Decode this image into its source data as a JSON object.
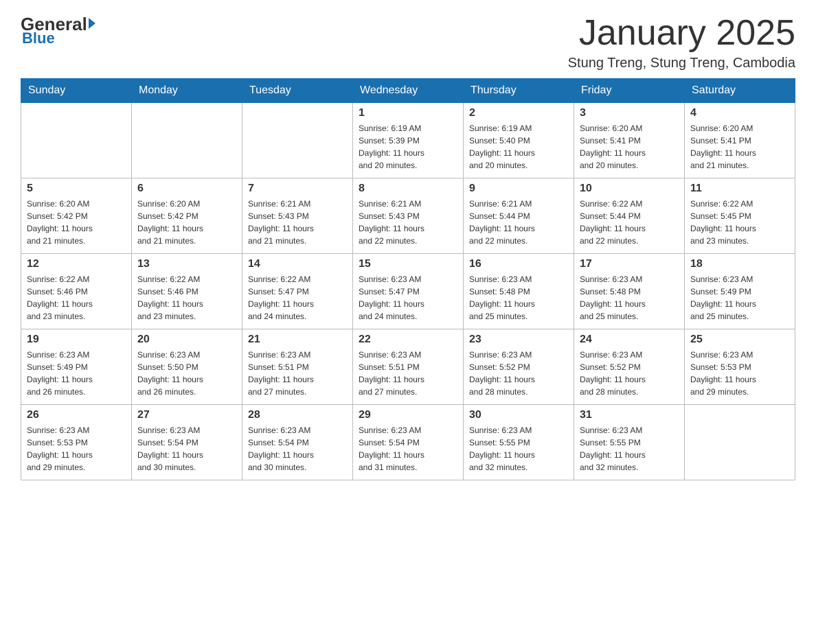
{
  "logo": {
    "general": "General",
    "blue": "Blue"
  },
  "title": "January 2025",
  "location": "Stung Treng, Stung Treng, Cambodia",
  "weekdays": [
    "Sunday",
    "Monday",
    "Tuesday",
    "Wednesday",
    "Thursday",
    "Friday",
    "Saturday"
  ],
  "weeks": [
    [
      {
        "day": "",
        "info": ""
      },
      {
        "day": "",
        "info": ""
      },
      {
        "day": "",
        "info": ""
      },
      {
        "day": "1",
        "info": "Sunrise: 6:19 AM\nSunset: 5:39 PM\nDaylight: 11 hours\nand 20 minutes."
      },
      {
        "day": "2",
        "info": "Sunrise: 6:19 AM\nSunset: 5:40 PM\nDaylight: 11 hours\nand 20 minutes."
      },
      {
        "day": "3",
        "info": "Sunrise: 6:20 AM\nSunset: 5:41 PM\nDaylight: 11 hours\nand 20 minutes."
      },
      {
        "day": "4",
        "info": "Sunrise: 6:20 AM\nSunset: 5:41 PM\nDaylight: 11 hours\nand 21 minutes."
      }
    ],
    [
      {
        "day": "5",
        "info": "Sunrise: 6:20 AM\nSunset: 5:42 PM\nDaylight: 11 hours\nand 21 minutes."
      },
      {
        "day": "6",
        "info": "Sunrise: 6:20 AM\nSunset: 5:42 PM\nDaylight: 11 hours\nand 21 minutes."
      },
      {
        "day": "7",
        "info": "Sunrise: 6:21 AM\nSunset: 5:43 PM\nDaylight: 11 hours\nand 21 minutes."
      },
      {
        "day": "8",
        "info": "Sunrise: 6:21 AM\nSunset: 5:43 PM\nDaylight: 11 hours\nand 22 minutes."
      },
      {
        "day": "9",
        "info": "Sunrise: 6:21 AM\nSunset: 5:44 PM\nDaylight: 11 hours\nand 22 minutes."
      },
      {
        "day": "10",
        "info": "Sunrise: 6:22 AM\nSunset: 5:44 PM\nDaylight: 11 hours\nand 22 minutes."
      },
      {
        "day": "11",
        "info": "Sunrise: 6:22 AM\nSunset: 5:45 PM\nDaylight: 11 hours\nand 23 minutes."
      }
    ],
    [
      {
        "day": "12",
        "info": "Sunrise: 6:22 AM\nSunset: 5:46 PM\nDaylight: 11 hours\nand 23 minutes."
      },
      {
        "day": "13",
        "info": "Sunrise: 6:22 AM\nSunset: 5:46 PM\nDaylight: 11 hours\nand 23 minutes."
      },
      {
        "day": "14",
        "info": "Sunrise: 6:22 AM\nSunset: 5:47 PM\nDaylight: 11 hours\nand 24 minutes."
      },
      {
        "day": "15",
        "info": "Sunrise: 6:23 AM\nSunset: 5:47 PM\nDaylight: 11 hours\nand 24 minutes."
      },
      {
        "day": "16",
        "info": "Sunrise: 6:23 AM\nSunset: 5:48 PM\nDaylight: 11 hours\nand 25 minutes."
      },
      {
        "day": "17",
        "info": "Sunrise: 6:23 AM\nSunset: 5:48 PM\nDaylight: 11 hours\nand 25 minutes."
      },
      {
        "day": "18",
        "info": "Sunrise: 6:23 AM\nSunset: 5:49 PM\nDaylight: 11 hours\nand 25 minutes."
      }
    ],
    [
      {
        "day": "19",
        "info": "Sunrise: 6:23 AM\nSunset: 5:49 PM\nDaylight: 11 hours\nand 26 minutes."
      },
      {
        "day": "20",
        "info": "Sunrise: 6:23 AM\nSunset: 5:50 PM\nDaylight: 11 hours\nand 26 minutes."
      },
      {
        "day": "21",
        "info": "Sunrise: 6:23 AM\nSunset: 5:51 PM\nDaylight: 11 hours\nand 27 minutes."
      },
      {
        "day": "22",
        "info": "Sunrise: 6:23 AM\nSunset: 5:51 PM\nDaylight: 11 hours\nand 27 minutes."
      },
      {
        "day": "23",
        "info": "Sunrise: 6:23 AM\nSunset: 5:52 PM\nDaylight: 11 hours\nand 28 minutes."
      },
      {
        "day": "24",
        "info": "Sunrise: 6:23 AM\nSunset: 5:52 PM\nDaylight: 11 hours\nand 28 minutes."
      },
      {
        "day": "25",
        "info": "Sunrise: 6:23 AM\nSunset: 5:53 PM\nDaylight: 11 hours\nand 29 minutes."
      }
    ],
    [
      {
        "day": "26",
        "info": "Sunrise: 6:23 AM\nSunset: 5:53 PM\nDaylight: 11 hours\nand 29 minutes."
      },
      {
        "day": "27",
        "info": "Sunrise: 6:23 AM\nSunset: 5:54 PM\nDaylight: 11 hours\nand 30 minutes."
      },
      {
        "day": "28",
        "info": "Sunrise: 6:23 AM\nSunset: 5:54 PM\nDaylight: 11 hours\nand 30 minutes."
      },
      {
        "day": "29",
        "info": "Sunrise: 6:23 AM\nSunset: 5:54 PM\nDaylight: 11 hours\nand 31 minutes."
      },
      {
        "day": "30",
        "info": "Sunrise: 6:23 AM\nSunset: 5:55 PM\nDaylight: 11 hours\nand 32 minutes."
      },
      {
        "day": "31",
        "info": "Sunrise: 6:23 AM\nSunset: 5:55 PM\nDaylight: 11 hours\nand 32 minutes."
      },
      {
        "day": "",
        "info": ""
      }
    ]
  ]
}
